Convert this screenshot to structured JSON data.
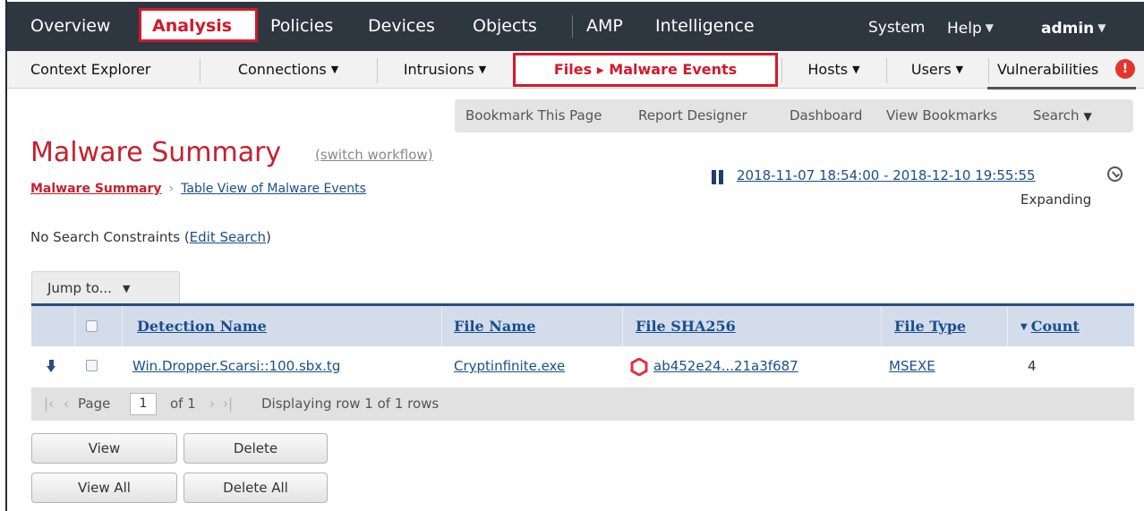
{
  "topnav": {
    "items": [
      "Overview",
      "Analysis",
      "Policies",
      "Devices",
      "Objects",
      "AMP",
      "Intelligence"
    ],
    "system": "System",
    "help": "Help",
    "user": "admin"
  },
  "subnav": {
    "tabs": [
      "Context Explorer",
      "Connections",
      "Intrusions",
      "Files ▸ Malware Events",
      "Hosts",
      "Users",
      "Vulnerabilities"
    ],
    "alert_badge": "!"
  },
  "toolbar": {
    "bookmark": "Bookmark This Page",
    "report_designer": "Report Designer",
    "dashboard": "Dashboard",
    "view_bookmarks": "View Bookmarks",
    "search": "Search"
  },
  "page": {
    "title": "Malware Summary",
    "switch_workflow": "(switch workflow)",
    "breadcrumb_current": "Malware Summary",
    "breadcrumb_next": "Table View of Malware Events",
    "time_range": "2018-11-07 18:54:00 - 2018-12-10 19:55:55",
    "expanding": "Expanding",
    "constraints_prefix": "No Search Constraints (",
    "constraints_link": "Edit Search",
    "constraints_suffix": ")",
    "jump_to": "Jump to..."
  },
  "table": {
    "columns": [
      "Detection Name",
      "File Name",
      "File SHA256",
      "File Type",
      "Count"
    ],
    "rows": [
      {
        "detection_name": "Win.Dropper.Scarsi::100.sbx.tg",
        "file_name": "Cryptinfinite.exe",
        "sha256": "ab452e24...21a3f687",
        "file_type": "MSEXE",
        "count": "4"
      }
    ]
  },
  "pager": {
    "page_label": "Page",
    "page_value": "1",
    "of_label": "of 1",
    "status": "Displaying row 1 of 1 rows"
  },
  "buttons": {
    "view": "View",
    "delete": "Delete",
    "view_all": "View All",
    "delete_all": "Delete All"
  },
  "colors": {
    "accent_red": "#c6202e",
    "nav_bg": "#2e3640",
    "link_blue": "#1a4e8c",
    "threat_icon": "#e0313c"
  }
}
